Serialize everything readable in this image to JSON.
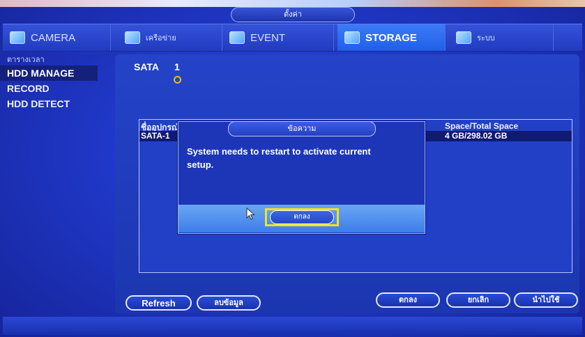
{
  "window": {
    "title": "ตั้งค่า"
  },
  "tabs": [
    {
      "label": "CAMERA",
      "icon": "camera-icon"
    },
    {
      "label": "เครือข่าย",
      "icon": "network-icon"
    },
    {
      "label": "EVENT",
      "icon": "event-icon"
    },
    {
      "label": "STORAGE",
      "icon": "storage-icon",
      "active": true
    },
    {
      "label": "ระบบ",
      "icon": "system-icon"
    }
  ],
  "sidebar": {
    "items": [
      {
        "label": "ตารางเวลา"
      },
      {
        "label": "HDD MANAGE",
        "active": true
      },
      {
        "label": "RECORD"
      },
      {
        "label": "HDD DETECT"
      }
    ]
  },
  "main": {
    "sata_label": "SATA",
    "sata_number": "1",
    "table": {
      "header_left": "ชื่ออุปกรณ์",
      "header_right": "Space/Total Space",
      "row_left": "SATA-1",
      "row_right": "4 GB/298.02 GB"
    },
    "buttons": {
      "refresh": "Refresh",
      "delete": "ลบข้อมูล",
      "ok": "ตกลง",
      "cancel": "ยกเลิก",
      "apply": "นำไปใช้"
    }
  },
  "dialog": {
    "title": "ข้อความ",
    "message": "System needs to restart to activate current setup.",
    "ok_label": "ตกลง"
  },
  "colors": {
    "accent_highlight": "#f7e313",
    "active_tab": "#2f6ff0",
    "background": "#2038c8"
  }
}
